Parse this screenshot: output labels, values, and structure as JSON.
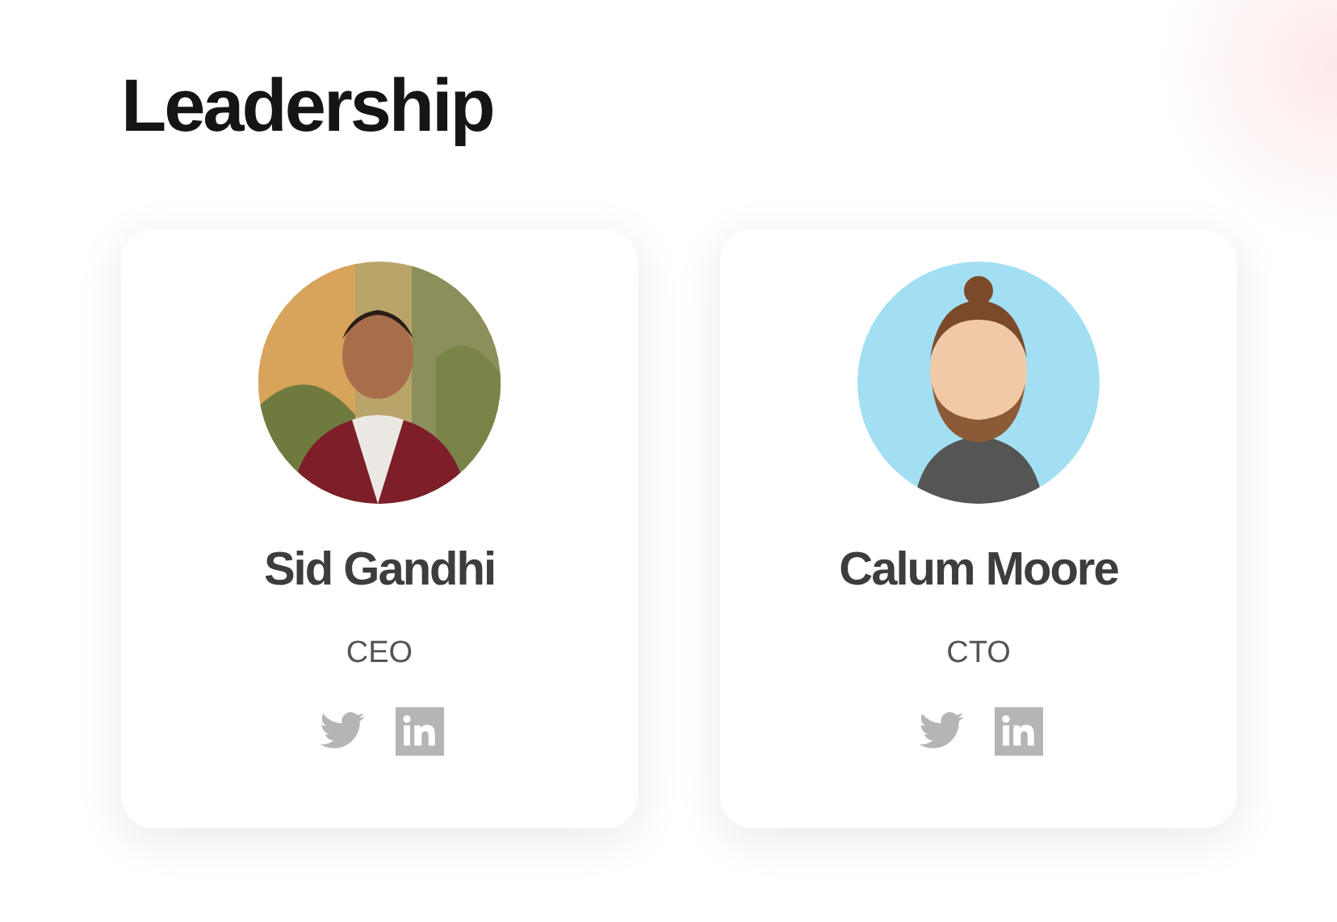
{
  "heading": "Leadership",
  "people": [
    {
      "name": "Sid Gandhi",
      "role": "CEO"
    },
    {
      "name": "Calum Moore",
      "role": "CTO",
      "photo": {
        "kind": "avatar"
      }
    }
  ]
}
